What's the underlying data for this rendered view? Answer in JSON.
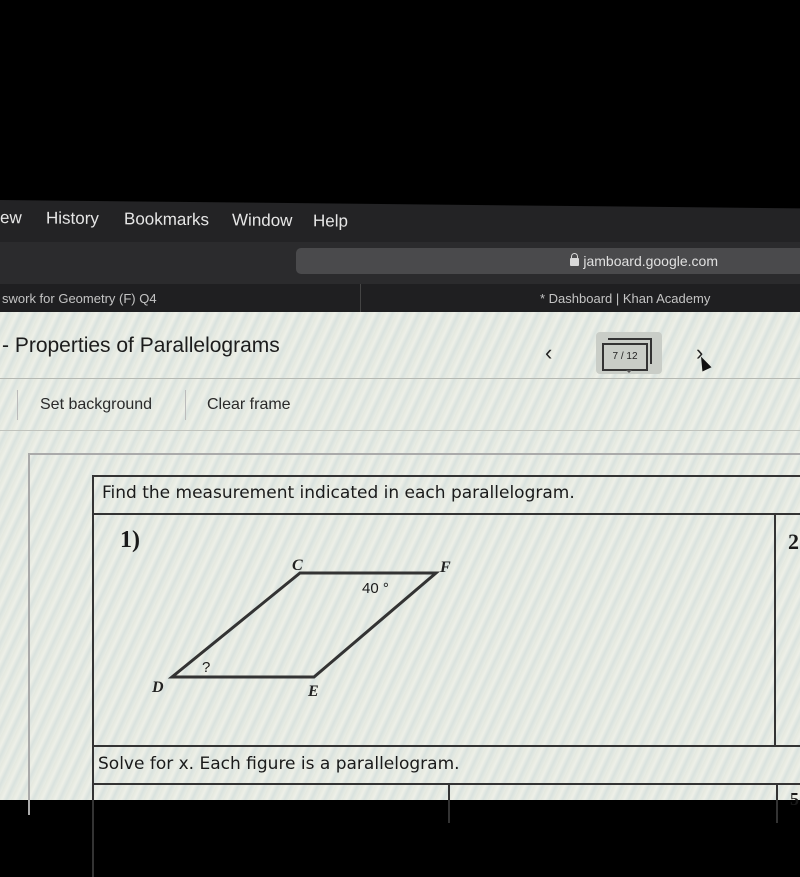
{
  "menubar": {
    "items": [
      "ew",
      "History",
      "Bookmarks",
      "Window",
      "Help"
    ]
  },
  "address_bar": {
    "url": "jamboard.google.com"
  },
  "tabs": [
    {
      "label": "swork for Geometry (F) Q4"
    },
    {
      "label": "* Dashboard | Khan Academy"
    }
  ],
  "jamboard": {
    "title": "- Properties of Parallelograms",
    "frame_counter": "7 / 12",
    "current_frame": 7,
    "total_frames": 12,
    "buttons": {
      "set_background": "Set background",
      "clear_frame": "Clear frame"
    }
  },
  "worksheet": {
    "section1_header": "Find the measurement indicated in each parallelogram.",
    "problem1_number": "1)",
    "problem2_number_partial": "2",
    "figure": {
      "vertices": {
        "C": "C",
        "F": "F",
        "D": "D",
        "E": "E"
      },
      "given_angle": "40 °",
      "unknown_angle": "?"
    },
    "section2_header": "Solve for x.  Each figure is a parallelogram.",
    "problem5_partial": "5"
  }
}
